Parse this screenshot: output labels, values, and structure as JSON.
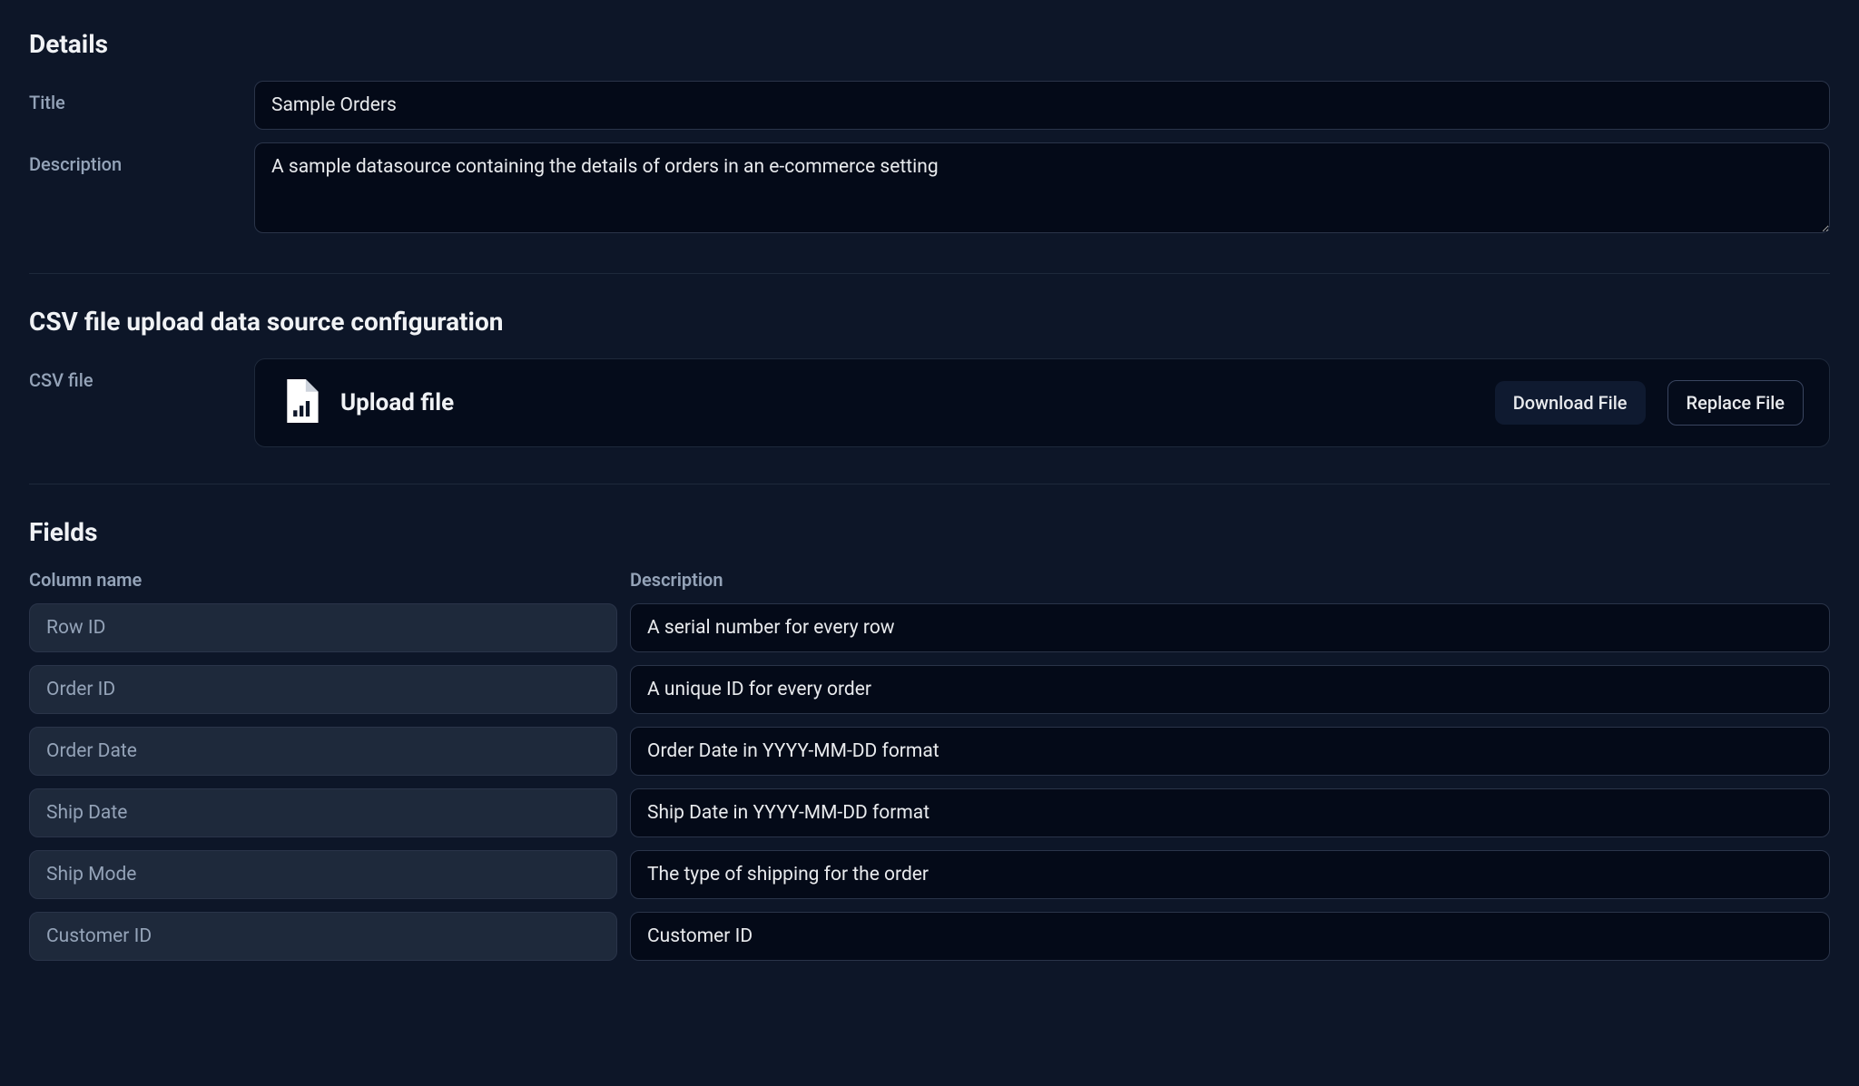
{
  "details": {
    "heading": "Details",
    "title_label": "Title",
    "title_value": "Sample Orders",
    "description_label": "Description",
    "description_value": "A sample datasource containing the details of orders in an e-commerce setting"
  },
  "csv_config": {
    "heading": "CSV file upload data source configuration",
    "label": "CSV file",
    "upload_title": "Upload file",
    "download_button": "Download File",
    "replace_button": "Replace File"
  },
  "fields": {
    "heading": "Fields",
    "column_name_header": "Column name",
    "description_header": "Description",
    "rows": [
      {
        "name": "Row ID",
        "description": "A serial number for every row"
      },
      {
        "name": "Order ID",
        "description": "A unique ID for every order"
      },
      {
        "name": "Order Date",
        "description": "Order Date in YYYY-MM-DD format"
      },
      {
        "name": "Ship Date",
        "description": "Ship Date in YYYY-MM-DD format"
      },
      {
        "name": "Ship Mode",
        "description": "The type of shipping for the order"
      },
      {
        "name": "Customer ID",
        "description": "Customer ID"
      }
    ]
  }
}
